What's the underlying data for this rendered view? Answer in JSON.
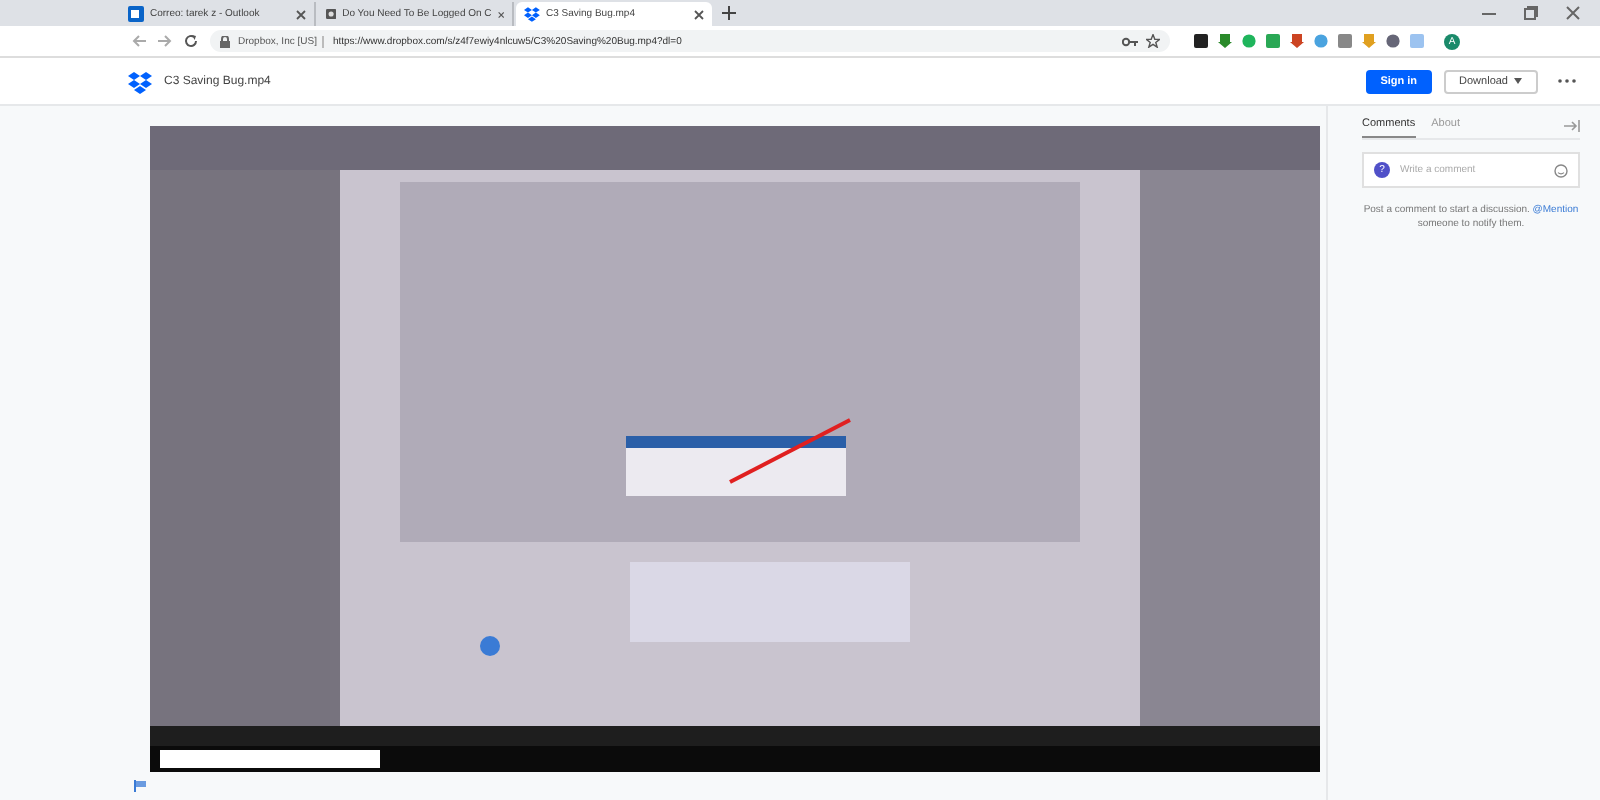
{
  "browser": {
    "tabs": [
      {
        "title": "Correo: tarek z - Outlook",
        "selected": false
      },
      {
        "title": "Do You Need To Be Logged On C",
        "selected": false
      },
      {
        "title": "C3 Saving Bug.mp4",
        "selected": true
      }
    ],
    "site_identity": "Dropbox, Inc [US]",
    "url": "https://www.dropbox.com/s/z4f7ewiy4nlcuw5/C3%20Saving%20Bug.mp4?dl=0",
    "profile_initial": "A"
  },
  "header": {
    "file_name": "C3 Saving Bug.mp4",
    "buttons": [
      {
        "label": "Sign in",
        "kind": "primary"
      },
      {
        "label": "Download",
        "kind": "dropdown"
      }
    ]
  },
  "sidebar": {
    "tabs": [
      {
        "label": "Comments",
        "selected": true
      },
      {
        "label": "About",
        "selected": false
      }
    ],
    "comment_field": {
      "placeholder": "Write a comment",
      "avatar_initial": "?"
    },
    "hint": "Post a comment to start a discussion.",
    "mention": "@Mention",
    "hint_after": "someone to notify them."
  }
}
